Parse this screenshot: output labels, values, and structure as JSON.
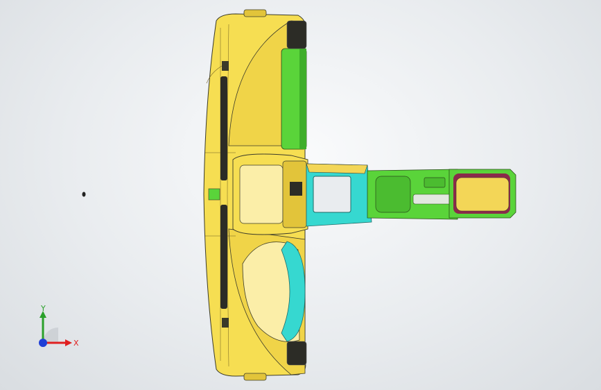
{
  "window": {
    "title": ""
  },
  "view": {
    "background_top": "#fafbfc",
    "background_bottom": "#d9dde1",
    "model_name": ""
  },
  "triad": {
    "x_label": "X",
    "y_label": "Y",
    "x_color": "#e02020",
    "y_color": "#2aa02a",
    "z_color": "#1f3fd6"
  },
  "colors": {
    "dash_yellow": "#f6de52",
    "dash_yellow_shade": "#e2c43a",
    "cluster_green": "#5ad43a",
    "console_cyan": "#36d8d0",
    "armrest_yellow": "#f3d657",
    "armrest_maroon": "#8a2b4a",
    "edge_line": "#3a3a2a"
  },
  "icons": {
    "triad": "coordinate-triad-icon",
    "origin": "origin-point-icon"
  }
}
